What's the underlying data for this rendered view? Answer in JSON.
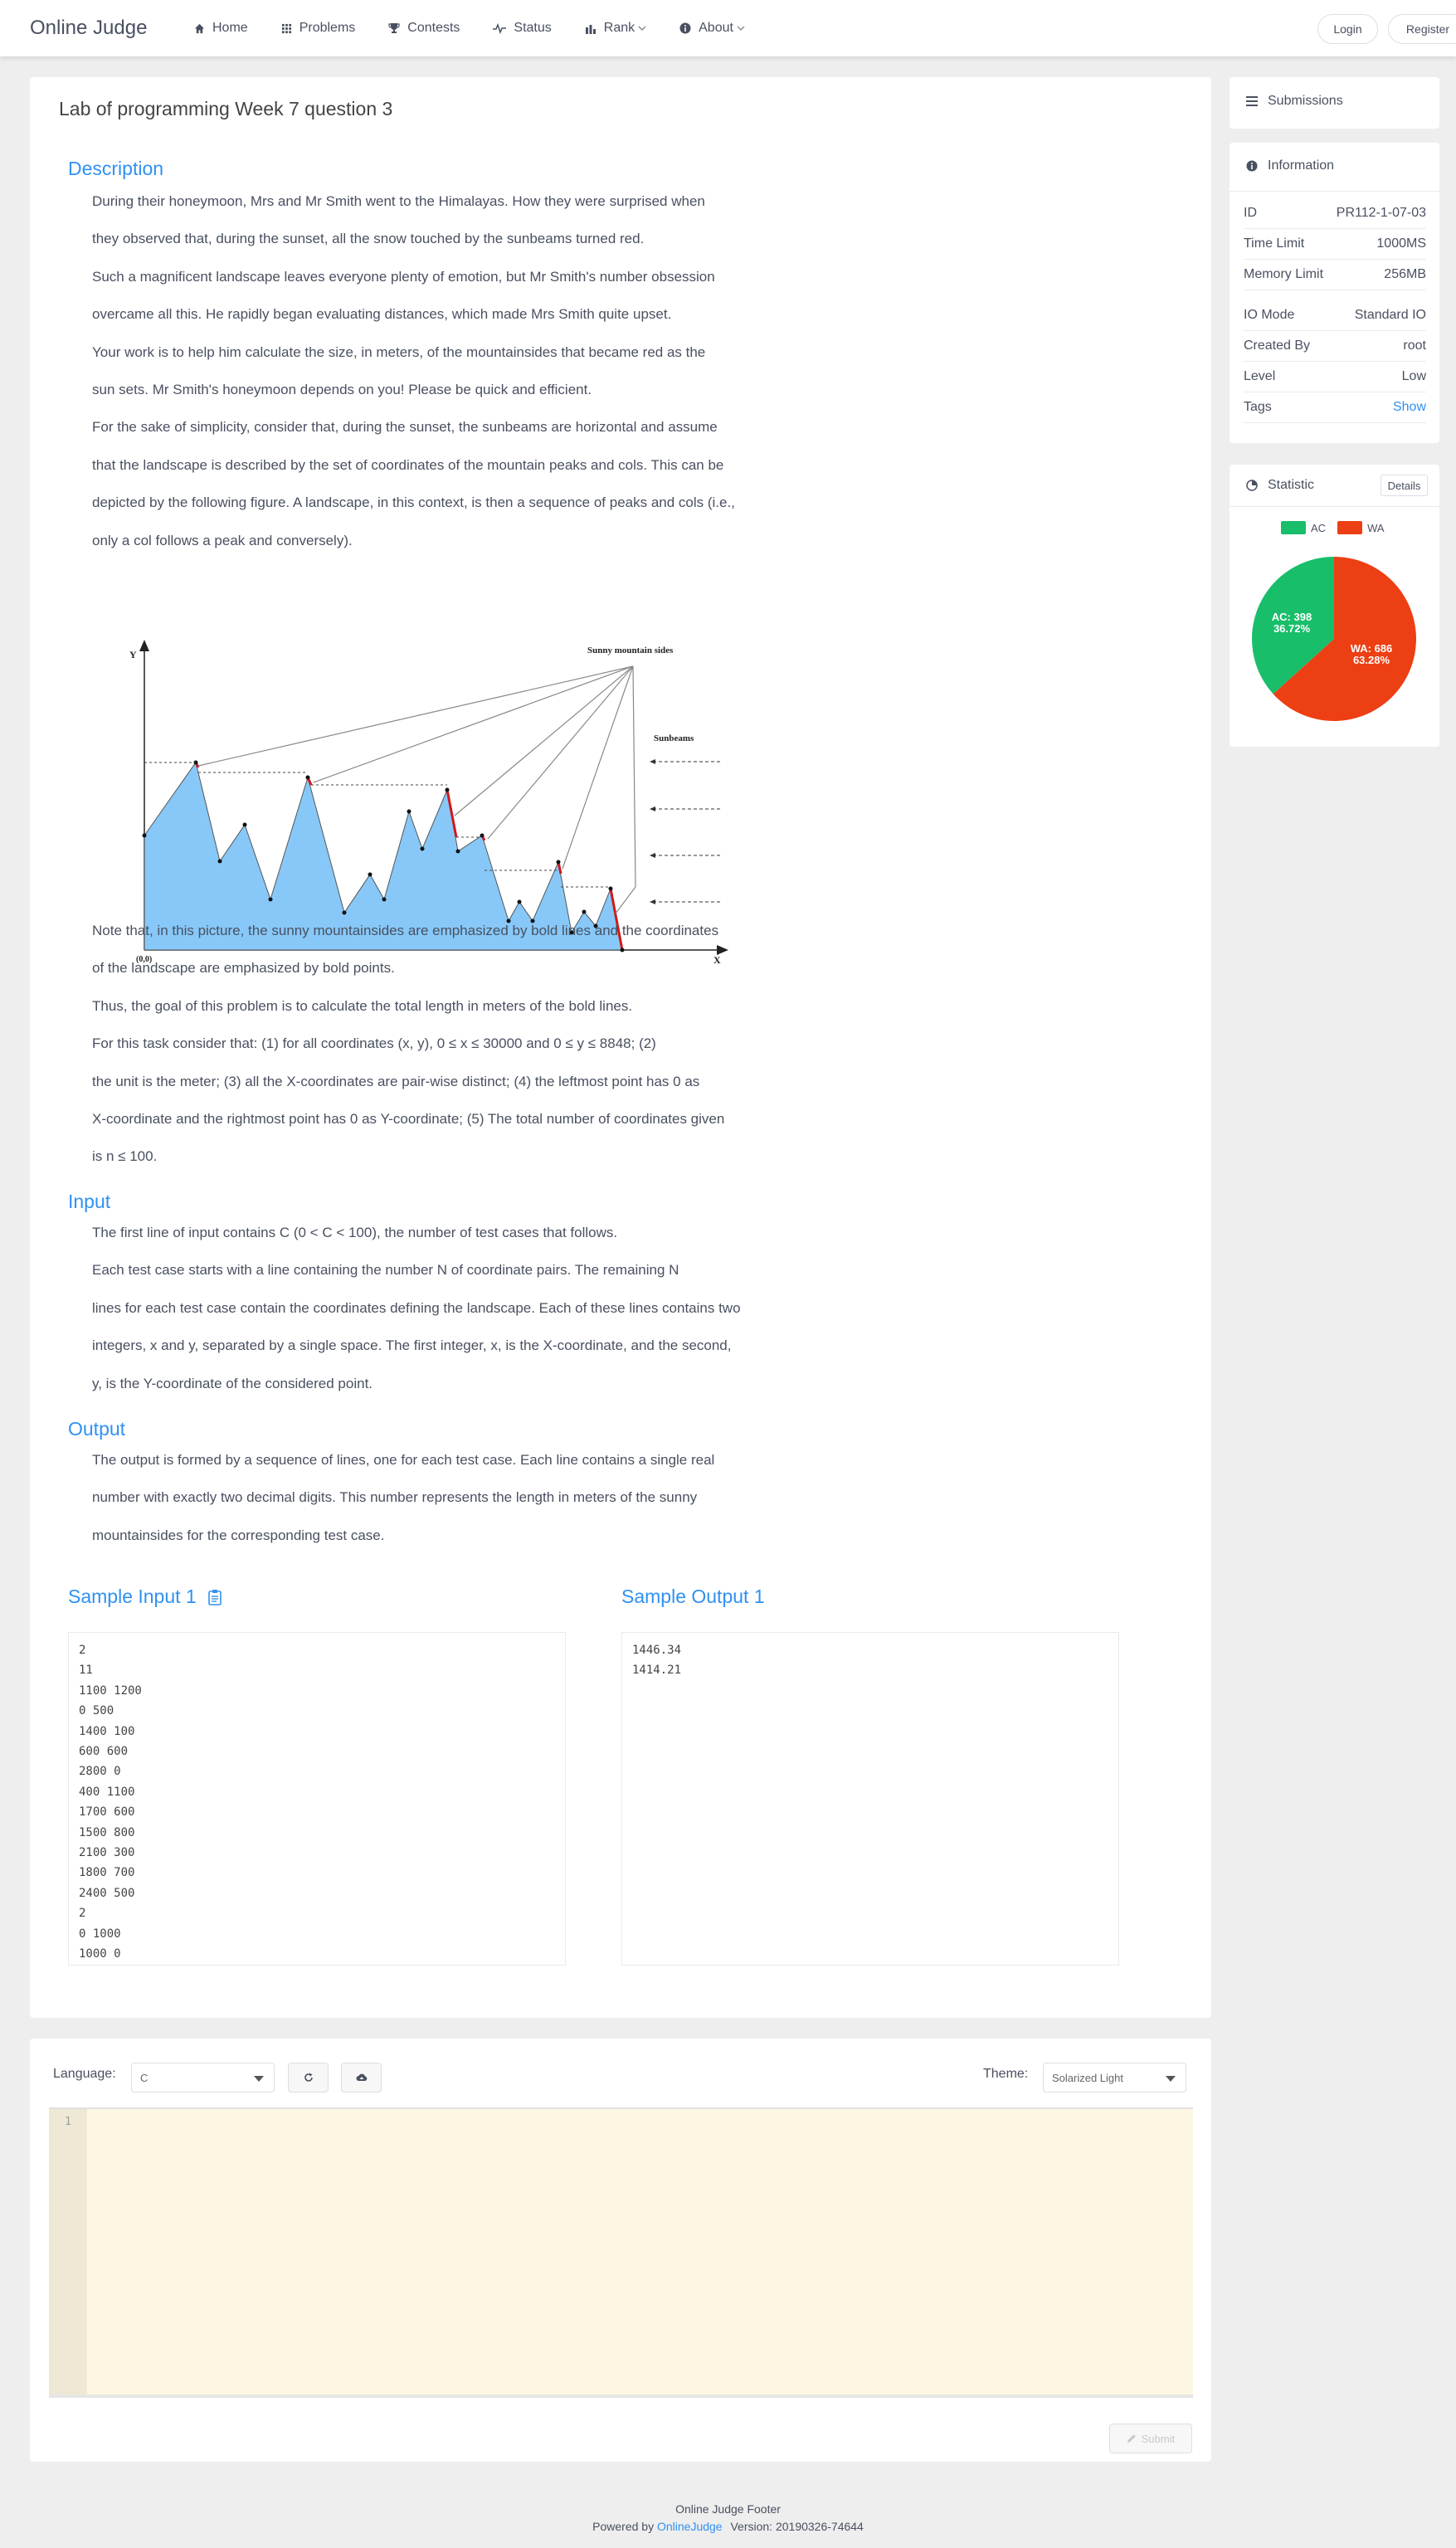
{
  "header": {
    "logo": "Online Judge",
    "nav": [
      {
        "label": "Home",
        "icon": "home-icon"
      },
      {
        "label": "Problems",
        "icon": "grid-icon"
      },
      {
        "label": "Contests",
        "icon": "trophy-icon"
      },
      {
        "label": "Status",
        "icon": "pulse-icon"
      },
      {
        "label": "Rank",
        "icon": "bar-chart-icon"
      },
      {
        "label": "About",
        "icon": "info-icon"
      }
    ],
    "login": "Login",
    "register": "Register"
  },
  "problem": {
    "title": "Lab of programming Week 7 question 3",
    "description_title": "Description",
    "description_lines": [
      "During their honeymoon, Mrs and Mr Smith went to the Himalayas. How they were surprised when",
      "they observed that, during the sunset, all the snow touched by the sunbeams turned red.",
      "Such a magnificent landscape leaves everyone plenty of emotion, but Mr Smith's number obsession",
      "overcame all this. He rapidly began evaluating distances, which made Mrs Smith quite upset.",
      "Your work is to help him calculate the size, in meters, of the mountainsides that became red as the",
      "sun sets. Mr Smith's honeymoon depends on you! Please be quick and efficient.",
      "For the sake of simplicity, consider that, during the sunset, the sunbeams are horizontal and assume",
      "that the landscape is described by the set of coordinates of the mountain peaks and cols. This can be",
      "depicted by the following figure. A landscape, in this context, is then a sequence of peaks and cols (i.e.,",
      "only a col follows a peak and conversely)."
    ],
    "figure": {
      "y_label": "Y",
      "x_label": "X",
      "origin": "(0,0)",
      "sunny_label": "Sunny mountain sides",
      "sunbeams_label": "Sunbeams"
    },
    "description_lines_2": [
      "Note that, in this picture, the sunny mountainsides are emphasized by bold lines and the coordinates",
      "of the landscape are emphasized by bold points.",
      "Thus, the goal of this problem is to calculate the total length in meters of the bold lines.",
      "For this task consider that: (1) for all coordinates (x, y), 0 ≤ x ≤ 30000 and 0 ≤ y ≤ 8848; (2)",
      "the unit is the meter; (3) all the X-coordinates are pair-wise distinct; (4) the leftmost point has 0 as",
      "X-coordinate and the rightmost point has 0 as Y-coordinate; (5) The total number of coordinates given",
      "is n ≤ 100."
    ],
    "input_title": "Input",
    "input_lines": [
      "The first line of input contains C (0 < C < 100), the number of test cases that follows.",
      "Each test case starts with a line containing the number N of coordinate pairs. The remaining N",
      "lines for each test case contain the coordinates defining the landscape. Each of these lines contains two",
      "integers, x and y, separated by a single space. The first integer, x, is the X-coordinate, and the second,",
      "y, is the Y-coordinate of the considered point."
    ],
    "output_title": "Output",
    "output_lines": [
      "The output is formed by a sequence of lines, one for each test case. Each line contains a single real",
      "number with exactly two decimal digits. This number represents the length in meters of the sunny",
      "mountainsides for the corresponding test case."
    ],
    "sample_input_title": "Sample Input 1",
    "sample_output_title": "Sample Output 1",
    "sample_input": [
      "2",
      "11",
      "1100 1200",
      "0 500",
      "1400 100",
      "600 600",
      "2800 0",
      "400 1100",
      "1700 600",
      "1500 800",
      "2100 300",
      "1800 700",
      "2400 500",
      "2",
      "0 1000",
      "1000 0"
    ],
    "sample_output": [
      "1446.34",
      "1414.21"
    ]
  },
  "sidebar": {
    "submissions": "Submissions",
    "information": "Information",
    "info_rows": [
      {
        "key": "ID",
        "value": "PR112-1-07-03"
      },
      {
        "key": "Time Limit",
        "value": "1000MS"
      },
      {
        "key": "Memory Limit",
        "value": "256MB"
      },
      {
        "key": "IO Mode",
        "value": "Standard IO"
      },
      {
        "key": "Created By",
        "value": "root"
      },
      {
        "key": "Level",
        "value": "Low"
      },
      {
        "key": "Tags",
        "value": "Show"
      }
    ],
    "statistic": "Statistic",
    "details": "Details",
    "legend_ac": "AC",
    "legend_wa": "WA",
    "ac_line1": "AC: 398",
    "ac_line2": "36.72%",
    "wa_line1": "WA: 686",
    "wa_line2": "63.28%",
    "ac_count": 398,
    "wa_count": 686,
    "ac_color": "#19be6b",
    "wa_color": "#ed3f14"
  },
  "editor": {
    "language_label": "Language:",
    "language_value": "C",
    "theme_label": "Theme:",
    "theme_value": "Solarized Light",
    "line_number": "1",
    "submit": "Submit"
  },
  "footer": {
    "title": "Online Judge Footer",
    "powered_by": "Powered by",
    "link": "OnlineJudge",
    "version": "Version: 20190326-74644"
  }
}
